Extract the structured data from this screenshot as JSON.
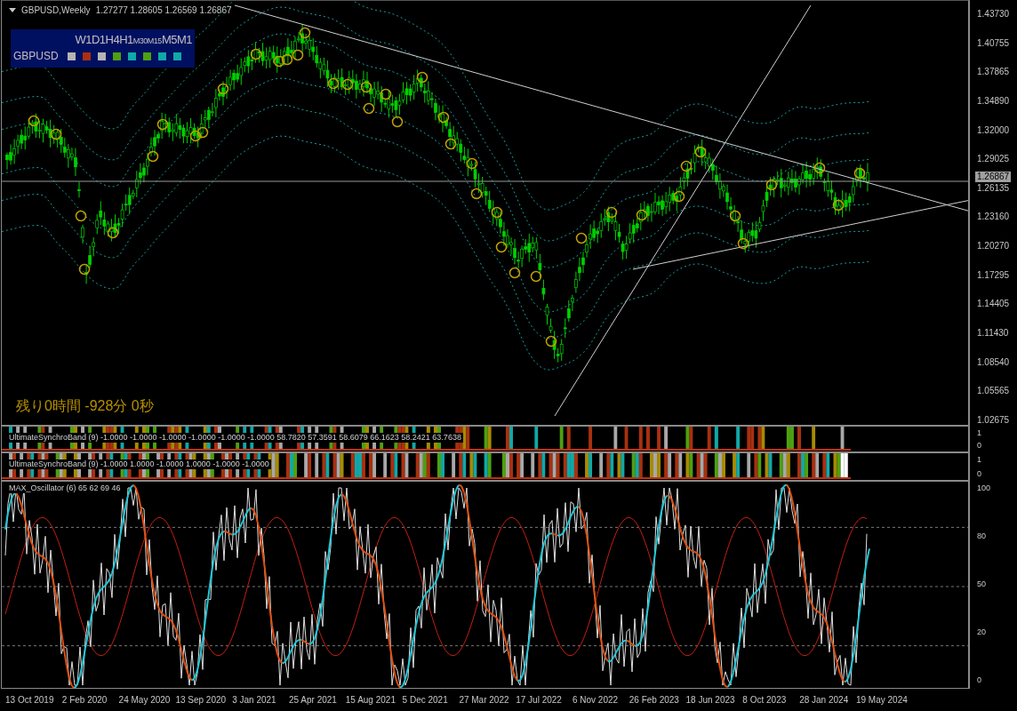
{
  "chart": {
    "title": "GBPUSD,Weekly",
    "ohlc": "1.27277 1.28605 1.26569 1.26867",
    "countdown": "残り0時間 -928分 0秒",
    "current_price": "1.26867",
    "price_axis": [
      "1.43730",
      "1.40755",
      "1.37865",
      "1.34890",
      "1.32000",
      "1.29025",
      "1.26135",
      "1.23160",
      "1.20270",
      "1.17295",
      "1.14405",
      "1.11430",
      "1.08540",
      "1.05565",
      "1.02675"
    ],
    "time_axis": [
      "13 Oct 2019",
      "2 Feb 2020",
      "24 May 2020",
      "13 Sep 2020",
      "3 Jan 2021",
      "25 Apr 2021",
      "15 Aug 2021",
      "5 Dec 2021",
      "27 Mar 2022",
      "17 Jul 2022",
      "6 Nov 2022",
      "26 Feb 2023",
      "18 Jun 2023",
      "8 Oct 2023",
      "28 Jan 2024",
      "19 May 2024"
    ]
  },
  "timeframe_panel": {
    "symbol": "GBPUSD",
    "timeframes": [
      {
        "label": "W1",
        "small": false,
        "color": "#b4b4b4"
      },
      {
        "label": "D1",
        "small": false,
        "color": "#a83010"
      },
      {
        "label": "H4",
        "small": false,
        "color": "#b4b4b4"
      },
      {
        "label": "H1",
        "small": false,
        "color": "#4ea010"
      },
      {
        "label": "M30",
        "small": true,
        "color": "#10a8a8"
      },
      {
        "label": "M15",
        "small": true,
        "color": "#4ea010"
      },
      {
        "label": "M5",
        "small": false,
        "color": "#10a8a8"
      },
      {
        "label": "M1",
        "small": false,
        "color": "#10a8a8"
      }
    ]
  },
  "indicators": [
    {
      "label": "UltimateSynchroBand (9) -1.0000 -1.0000 -1.0000 -1.0000 -1.0000 -1.0000 58.7820 57.3591 58.6079 66.1623 58.2421 63.7638",
      "axis": [
        "1",
        "0"
      ]
    },
    {
      "label": "UltimateSynchroBand (9) -1.0000 1.0000 -1.0000 1.0000 -1.0000 -1.0000",
      "axis": [
        "1",
        "0"
      ]
    }
  ],
  "oscillator": {
    "label": "MAX_Oscillator (6) 65 62 69 46",
    "axis": [
      "100",
      "80",
      "50",
      "20",
      "0"
    ]
  }
}
